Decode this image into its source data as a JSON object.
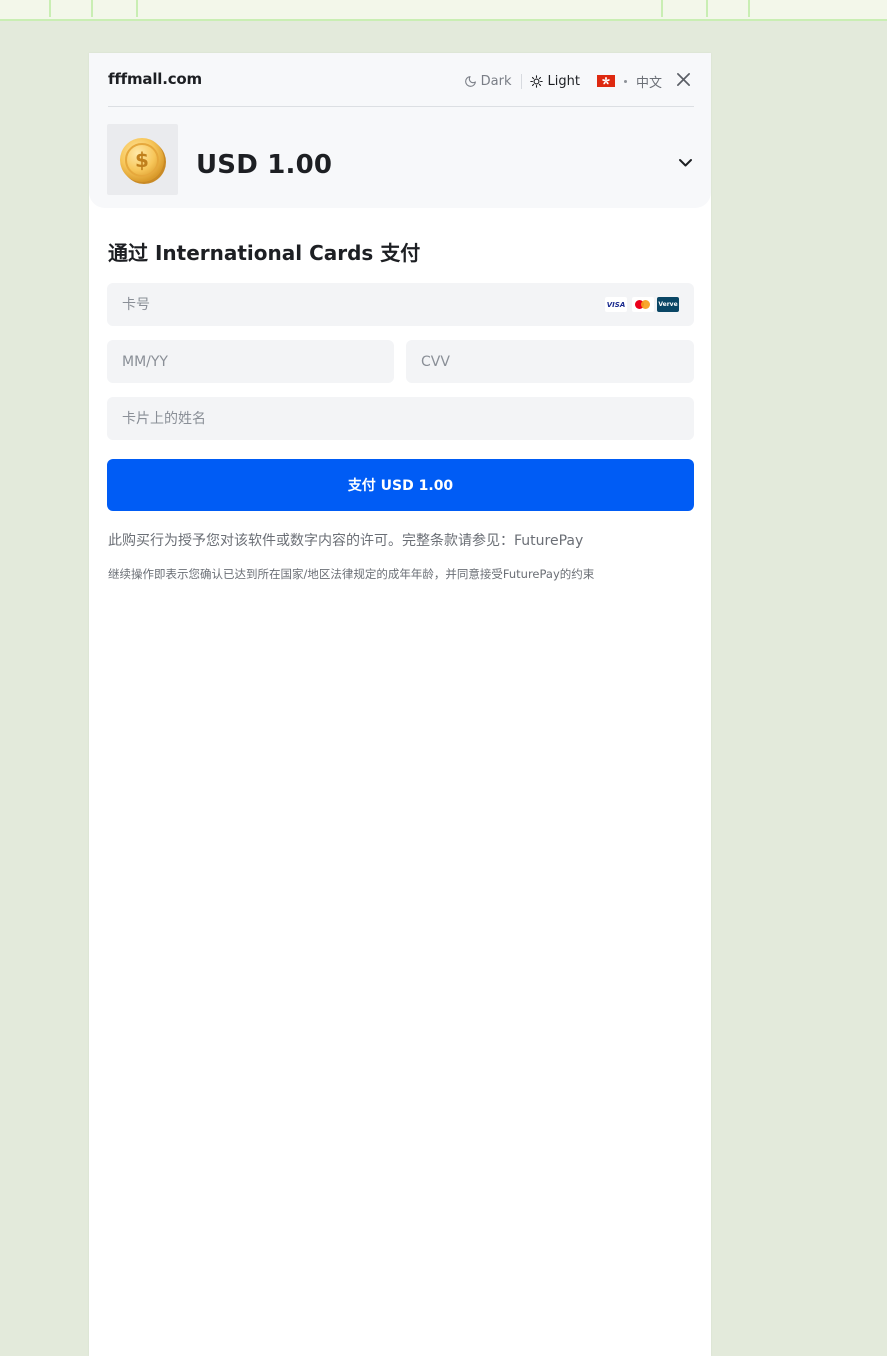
{
  "header": {
    "site_name": "fffmall.com",
    "theme_dark_label": "Dark",
    "theme_light_label": "Light",
    "language_label": "中文",
    "active_theme": "light"
  },
  "order": {
    "amount": "USD 1.00",
    "product_icon": "coin-icon"
  },
  "payment": {
    "title": "通过 International Cards 支付",
    "card_number_placeholder": "卡号",
    "expiry_placeholder": "MM/YY",
    "cvv_placeholder": "CVV",
    "name_placeholder": "卡片上的姓名",
    "card_brands": [
      "VISA",
      "Mastercard",
      "Verve"
    ],
    "visa_text": "VISA",
    "verve_text": "Verve",
    "pay_button_label": "支付 USD 1.00",
    "accent_color": "#005cf5"
  },
  "legal": {
    "terms_text": "此购买行为授予您对该软件或数字内容的许可。完整条款请参见：",
    "terms_link": "FuturePay",
    "age_text": "继续操作即表示您确认已达到所在国家/地区法律规定的成年年龄，并同意接受",
    "age_link": "FuturePay",
    "age_suffix": "的约束"
  }
}
